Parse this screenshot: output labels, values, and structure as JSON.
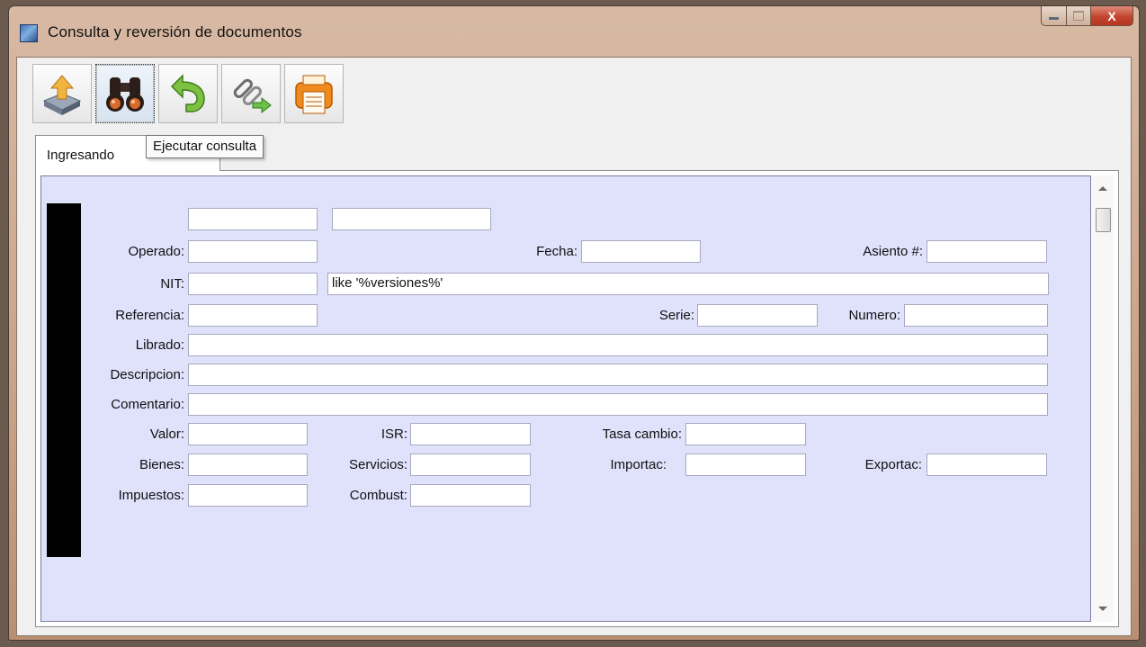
{
  "window": {
    "title": "Consulta y reversión de documentos",
    "close_glyph": "X"
  },
  "toolbar": {
    "buttons": [
      {
        "name": "save-upload-icon"
      },
      {
        "name": "binoculars-icon"
      },
      {
        "name": "undo-arrow-icon"
      },
      {
        "name": "link-arrow-icon"
      },
      {
        "name": "printer-icon"
      }
    ],
    "tooltip": "Ejecutar consulta"
  },
  "tab": {
    "label": "Ingresando"
  },
  "form": {
    "labels": {
      "operado": "Operado:",
      "fecha": "Fecha:",
      "asiento": "Asiento #:",
      "nit": "NIT:",
      "referencia": "Referencia:",
      "serie": "Serie:",
      "numero": "Numero:",
      "librado": "Librado:",
      "descripcion": "Descripcion:",
      "comentario": "Comentario:",
      "valor": "Valor:",
      "isr": "ISR:",
      "tasa_cambio": "Tasa cambio:",
      "bienes": "Bienes:",
      "servicios": "Servicios:",
      "importac": "Importac:",
      "exportac": "Exportac:",
      "impuestos": "Impuestos:",
      "combust": "Combust:"
    },
    "values": {
      "top_field_1": "",
      "top_field_2": "",
      "operado": "",
      "fecha": "",
      "asiento": "",
      "nit": "",
      "nit_filter": "like '%versiones%'",
      "referencia": "",
      "serie": "",
      "numero": "",
      "librado": "",
      "descripcion": "",
      "comentario": "",
      "valor": "",
      "isr": "",
      "tasa_cambio": "",
      "bienes": "",
      "servicios": "",
      "importac": "",
      "exportac": "",
      "impuestos": "",
      "combust": ""
    }
  }
}
